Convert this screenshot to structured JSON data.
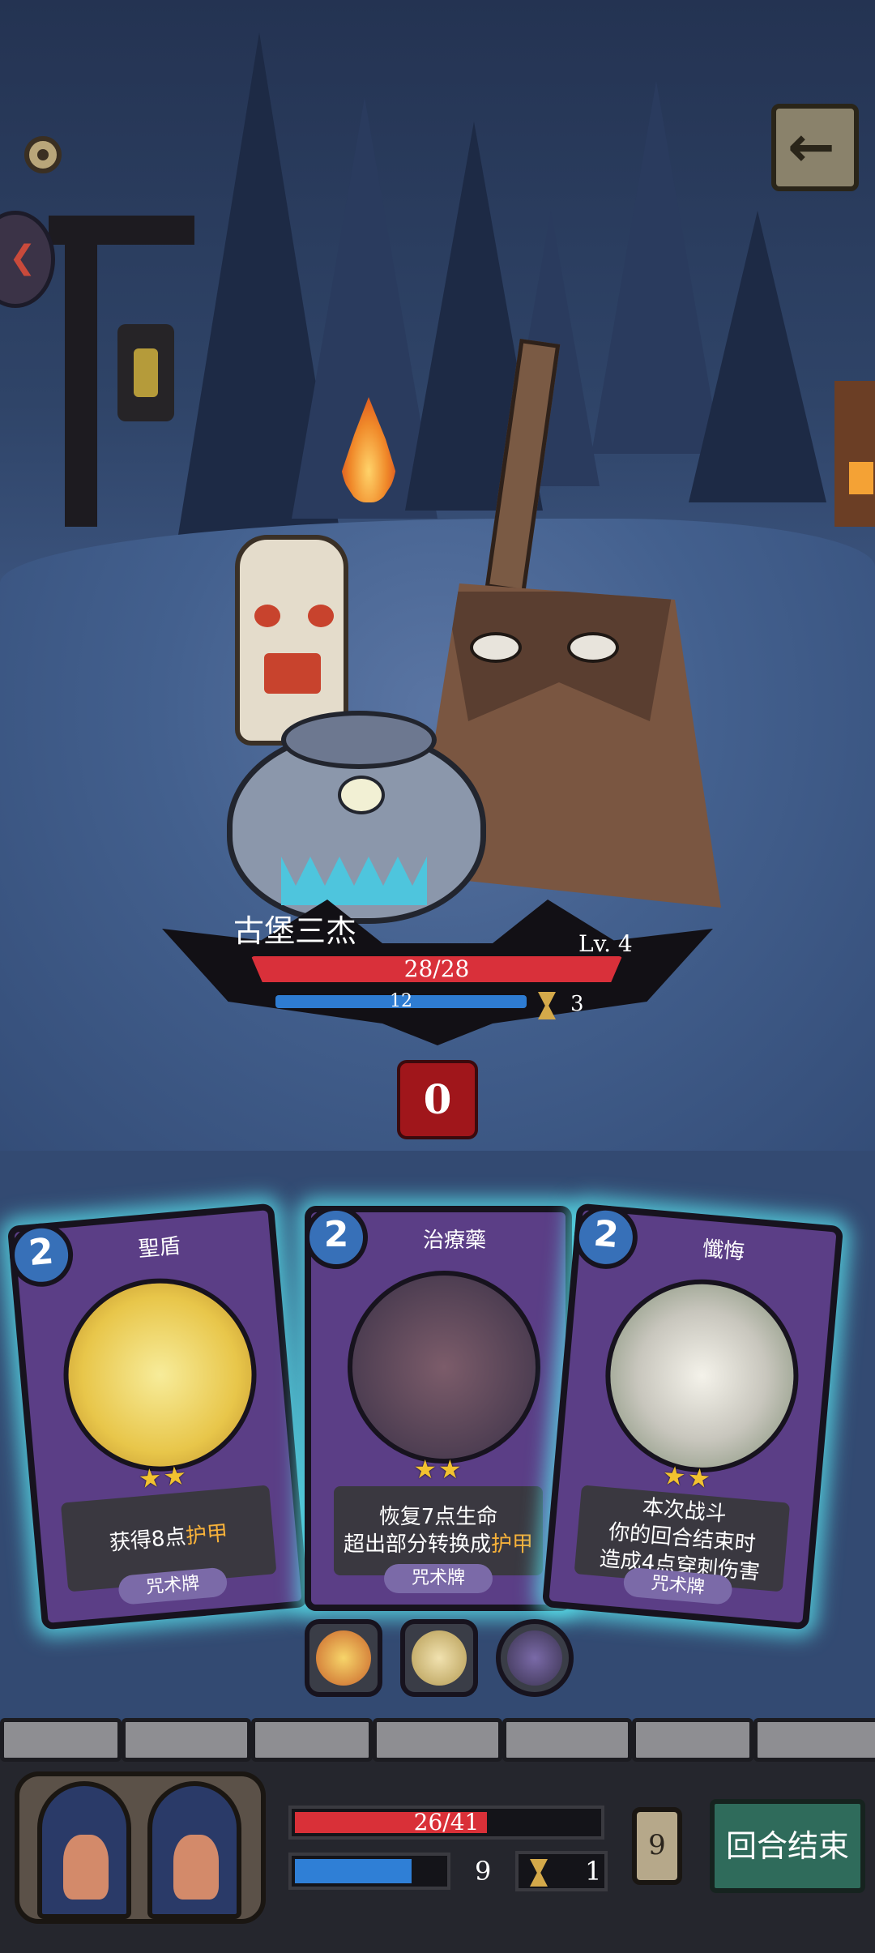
{
  "enemy": {
    "name": "古堡三杰",
    "level": "Lv. 4",
    "hp_text": "28/28",
    "hp_fraction": 1.0,
    "mp_text": "12",
    "time_text": "3",
    "intent_value": "0"
  },
  "cards": [
    {
      "cost": "2",
      "name": "聖盾",
      "stars": "★★",
      "desc_pre": "获得8点",
      "desc_kw": "护甲",
      "desc_post": "",
      "type": "咒术牌"
    },
    {
      "cost": "2",
      "name": "治療藥",
      "stars": "★★",
      "desc_pre": "恢复7点生命\n超出部分转换成",
      "desc_kw": "护甲",
      "desc_post": "",
      "type": "咒术牌"
    },
    {
      "cost": "2",
      "name": "懺悔",
      "stars": "★★",
      "desc_pre": "本次战斗\n你的回合结束时\n造成4点穿刺伤害",
      "desc_kw": "",
      "desc_post": "",
      "type": "咒术牌"
    }
  ],
  "relics": [
    "phoenix-feather-icon",
    "wizard-icon",
    "spellbook-icon"
  ],
  "player": {
    "hp_text": "26/41",
    "hp_fraction": 0.634,
    "mp_value": "9",
    "mp_fraction": 0.78,
    "time_value": "1",
    "deck_count": "9"
  },
  "buttons": {
    "end_turn": "回合结束",
    "back": "back-arrow-icon",
    "settings": "settings-icon"
  },
  "colors": {
    "hp_red": "#d93038",
    "mp_blue": "#2f7fd6",
    "card_glow": "#5ae6f0",
    "keyword": "#f6b13a"
  }
}
